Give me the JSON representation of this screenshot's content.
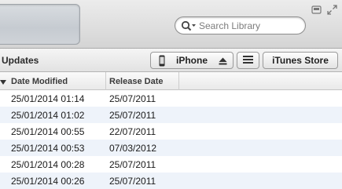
{
  "search": {
    "placeholder": "Search Library"
  },
  "toolbar": {
    "view_label": "Updates",
    "device_label": "iPhone",
    "store_label": "iTunes Store"
  },
  "table": {
    "columns": [
      "Date Modified",
      "Release Date"
    ],
    "rows": [
      {
        "date_modified": "25/01/2014 01:14",
        "release_date": "25/07/2011"
      },
      {
        "date_modified": "25/01/2014 01:02",
        "release_date": "25/07/2011"
      },
      {
        "date_modified": "25/01/2014 00:55",
        "release_date": "22/07/2011"
      },
      {
        "date_modified": "25/01/2014 00:53",
        "release_date": "07/03/2012"
      },
      {
        "date_modified": "25/01/2014 00:28",
        "release_date": "25/07/2011"
      },
      {
        "date_modified": "25/01/2014 00:26",
        "release_date": "25/07/2011"
      }
    ]
  },
  "icons": [
    "search-icon",
    "miniplayer-icon",
    "fullscreen-icon",
    "iphone-icon",
    "eject-icon",
    "menu-icon",
    "sort-arrow-icon"
  ],
  "colors": {
    "row_alt": "#eef3fa",
    "toolbar": "#e2e2e2"
  }
}
